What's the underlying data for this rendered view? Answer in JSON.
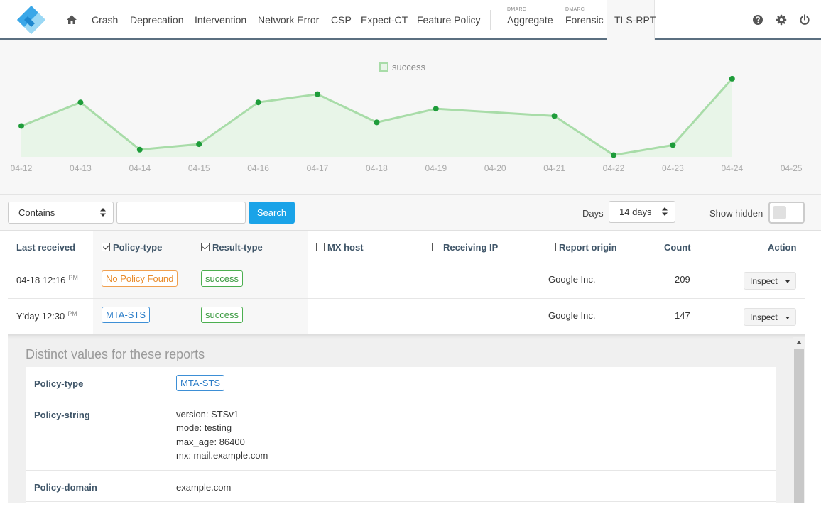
{
  "nav": {
    "items": [
      {
        "label": "Crash"
      },
      {
        "label": "Deprecation"
      },
      {
        "label": "Intervention"
      },
      {
        "label": "Network Error"
      },
      {
        "label": "CSP"
      },
      {
        "label": "Expect-CT"
      },
      {
        "label": "Feature Policy"
      }
    ],
    "dmarc_aggregate": {
      "sup": "DMARC",
      "label": "Aggregate"
    },
    "dmarc_forensic": {
      "sup": "DMARC",
      "label": "Forensic"
    },
    "active": {
      "label": "TLS-RPT"
    },
    "icons": [
      "home-icon",
      "help-icon",
      "gear-icon",
      "power-icon"
    ]
  },
  "chart_data": {
    "type": "area",
    "title": "",
    "legend": {
      "entries": [
        "success"
      ],
      "placement": "top-center"
    },
    "x": [
      "04-12",
      "04-13",
      "04-14",
      "04-15",
      "04-16",
      "04-17",
      "04-18",
      "04-19",
      "04-20",
      "04-21",
      "04-22",
      "04-23",
      "04-24",
      "04-25"
    ],
    "series": [
      {
        "name": "success",
        "points": [
          {
            "x": "04-12",
            "y": 34
          },
          {
            "x": "04-13",
            "y": 60
          },
          {
            "x": "04-14",
            "y": 8
          },
          {
            "x": "04-15",
            "y": 14
          },
          {
            "x": "04-16",
            "y": 60
          },
          {
            "x": "04-17",
            "y": 69
          },
          {
            "x": "04-18",
            "y": 38
          },
          {
            "x": "04-19",
            "y": 53
          },
          {
            "x": "04-21",
            "y": 45
          },
          {
            "x": "04-22",
            "y": 2
          },
          {
            "x": "04-23",
            "y": 13
          },
          {
            "x": "04-24",
            "y": 86
          }
        ]
      }
    ],
    "ylim": [
      0,
      100
    ],
    "colors": {
      "line": "#a8dca8",
      "fill": "#e8f5e8",
      "point": "#1e9c3a"
    },
    "grid": false
  },
  "controls": {
    "match_select": "Contains",
    "search_value": "",
    "search_label": "Search",
    "days_label": "Days",
    "days_select": "14 days",
    "show_hidden_label": "Show hidden"
  },
  "table": {
    "headers": {
      "last_received": "Last received",
      "policy_type": "Policy-type",
      "result_type": "Result-type",
      "mx_host": "MX host",
      "receiving_ip": "Receiving IP",
      "report_origin": "Report origin",
      "count": "Count",
      "action": "Action"
    },
    "checks": {
      "policy_type": true,
      "result_type": true,
      "mx_host": false,
      "receiving_ip": false,
      "report_origin": false
    },
    "rows": [
      {
        "date": "04-18 12:16",
        "ampm": "PM",
        "policy": "No Policy Found",
        "result": "success",
        "origin": "Google Inc.",
        "count": "209",
        "action": "Inspect"
      },
      {
        "date": "Y'day 12:30",
        "ampm": "PM",
        "policy": "MTA-STS",
        "result": "success",
        "origin": "Google Inc.",
        "count": "147",
        "action": "Inspect"
      }
    ]
  },
  "details": {
    "title": "Distinct values for these reports",
    "rows": [
      {
        "key": "Policy-type",
        "value": "MTA-STS"
      },
      {
        "key": "Policy-string",
        "lines": [
          "version: STSv1",
          "mode: testing",
          "max_age: 86400",
          "mx: mail.example.com"
        ]
      },
      {
        "key": "Policy-domain",
        "value": "example.com"
      }
    ]
  }
}
